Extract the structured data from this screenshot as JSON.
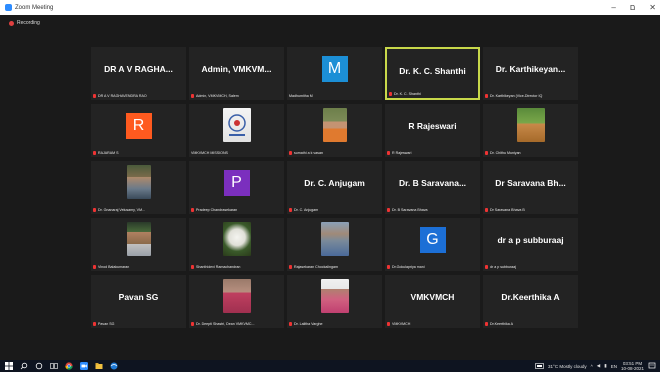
{
  "window": {
    "title": "Zoom Meeting",
    "min": "–",
    "max": "ם",
    "close": "✕"
  },
  "recording": {
    "label": "Recording"
  },
  "tiles": [
    {
      "name": "DR A V RAGHA...",
      "label": "DR A V RAGHAVENDRA RAO"
    },
    {
      "name": "Admin, VMKVM...",
      "label": "Admin, VMKVMCH, Salem"
    },
    {
      "avatar": "M",
      "label": "Madhumitha M"
    },
    {
      "name": "Dr. K. C. Shanthi",
      "label": "Dr. K. C. Shanthi"
    },
    {
      "name": "Dr. Karthikeyan...",
      "label": "Dr. Karthikeyan (Vice-Director IQ"
    },
    {
      "avatar": "R",
      "label": "RAJARAM S"
    },
    {
      "label": "VMKVMCH MISSIONS"
    },
    {
      "label": "sumathi a k vasan"
    },
    {
      "name": "R Rajeswari",
      "label": "R Rajeswari"
    },
    {
      "label": "Dr. Chithu Muniyan"
    },
    {
      "label": "Dr. Gnanaraj Velusamy, VM..."
    },
    {
      "avatar": "P",
      "label": "Pradeep Chandrasekaran"
    },
    {
      "name": "Dr. C. Anjugam",
      "label": "Dr. C. Anjugam"
    },
    {
      "name": "Dr. B Saravana...",
      "label": "Dr. B Saravana Bhava"
    },
    {
      "name": "Dr Saravana Bh...",
      "label": "Dr Saravana Bhava B"
    },
    {
      "label": "Vinod Balakumaran"
    },
    {
      "label": "Shanthidevi Ramachandran"
    },
    {
      "label": "Rajasekaran Chockalingam"
    },
    {
      "avatar": "G",
      "label": "Dr.Gokulapriya mani"
    },
    {
      "name": "dr a p subburaaj",
      "label": "dr a p subburaaj"
    },
    {
      "name": "Pavan SG",
      "label": "Pavan SG"
    },
    {
      "label": "Dr. Deepti Shastri, Dean VMKVMC..."
    },
    {
      "label": "Dr. Lalitha Varghe"
    },
    {
      "name": "VMKVMCH",
      "label": "VMKVMCH"
    },
    {
      "name": "Dr.Keerthika A",
      "label": "Dr.Keerthika A"
    }
  ],
  "taskbar": {
    "weather": "31°C  Mostly cloudy",
    "time": "03:51 PM",
    "date": "10-08-2021",
    "lang": "EN"
  },
  "colors": {
    "active_border": "#c8d84a",
    "avatar_M": "#1c8fd6",
    "avatar_R": "#ff5a1f",
    "avatar_P": "#7b2fbe",
    "avatar_G": "#1c6fd6"
  }
}
